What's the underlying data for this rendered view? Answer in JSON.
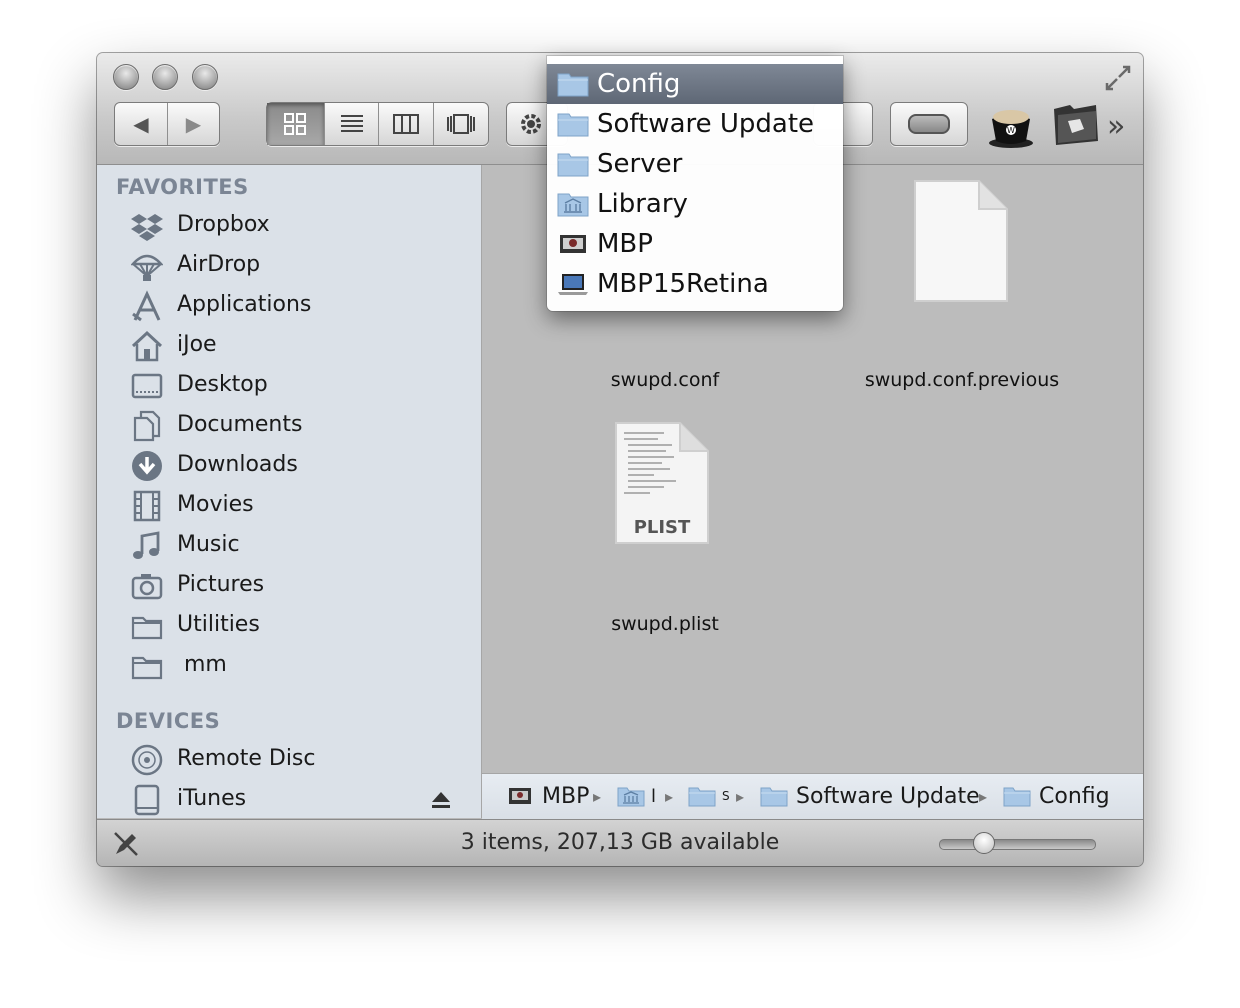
{
  "sidebar": {
    "favorites_header": "FAVORITES",
    "devices_header": "DEVICES",
    "favorites": [
      {
        "label": "Dropbox",
        "icon": "dropbox-icon"
      },
      {
        "label": "AirDrop",
        "icon": "airdrop-icon"
      },
      {
        "label": "Applications",
        "icon": "applications-icon"
      },
      {
        "label": "iJoe",
        "icon": "home-icon"
      },
      {
        "label": "Desktop",
        "icon": "desktop-icon"
      },
      {
        "label": "Documents",
        "icon": "documents-icon"
      },
      {
        "label": "Downloads",
        "icon": "downloads-icon"
      },
      {
        "label": "Movies",
        "icon": "movies-icon"
      },
      {
        "label": "Music",
        "icon": "music-icon"
      },
      {
        "label": "Pictures",
        "icon": "pictures-icon"
      },
      {
        "label": "Utilities",
        "icon": "folder-icon"
      },
      {
        "label": "mm",
        "icon": "folder-icon"
      }
    ],
    "devices": [
      {
        "label": "Remote Disc",
        "icon": "disc-icon"
      },
      {
        "label": "iTunes",
        "icon": "drive-icon"
      }
    ]
  },
  "files": [
    {
      "name": "swupd.conf",
      "icon": "document-icon"
    },
    {
      "name": "swupd.conf.previous",
      "icon": "document-icon"
    },
    {
      "name": "swupd.plist",
      "icon": "plist-icon",
      "badge": "PLIST"
    }
  ],
  "path_menu": [
    {
      "label": "Config",
      "icon": "folder-icon",
      "selected": true
    },
    {
      "label": "Software Update",
      "icon": "folder-icon"
    },
    {
      "label": "Server",
      "icon": "folder-icon"
    },
    {
      "label": "Library",
      "icon": "library-folder-icon"
    },
    {
      "label": "MBP",
      "icon": "hard-drive-icon"
    },
    {
      "label": "MBP15Retina",
      "icon": "laptop-icon"
    }
  ],
  "pathbar": {
    "items": [
      "MBP",
      "Software Update",
      "Config"
    ],
    "separator": "▸",
    "truncated_marks": [
      "l",
      "S"
    ]
  },
  "status": {
    "text": "3 items, 207,13 GB available",
    "icon_size_level": 0.25
  },
  "toolbar": {
    "back_glyph": "◀",
    "forward_glyph": "▶",
    "overflow_glyph": "»",
    "active_view": "icon"
  },
  "colors": {
    "sidebar_bg": "#dbe1e8",
    "content_bg": "#bcbcbc",
    "menu_selected": "#6b7482",
    "sidebar_header": "#7b8594"
  }
}
